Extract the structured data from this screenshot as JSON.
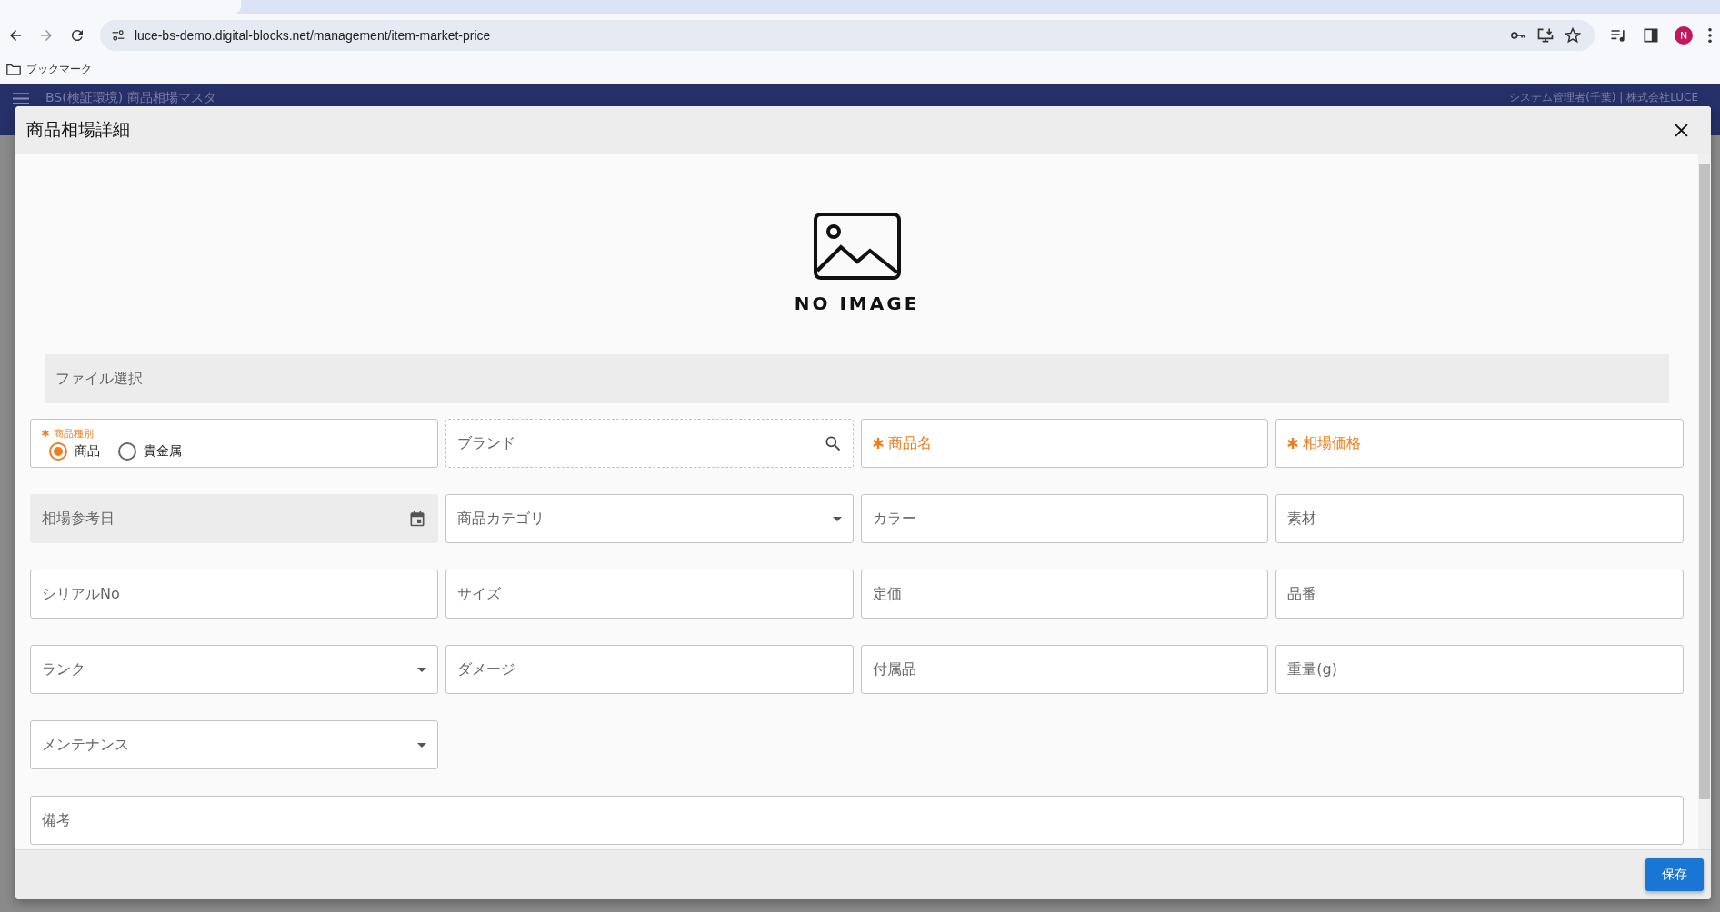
{
  "browser": {
    "url": "luce-bs-demo.digital-blocks.net/management/item-market-price",
    "bookmarks": [
      {
        "label": "ブックマーク"
      }
    ],
    "profile_initial": "N"
  },
  "app": {
    "title": "BS(検証環境) 商品相場マスタ",
    "user": "システム管理者(千葉) | 株式会社LUCE"
  },
  "dialog": {
    "title": "商品相場詳細",
    "image_caption": "NO IMAGE",
    "file_select": "ファイル選択",
    "fields": [
      {
        "kind": "radio",
        "label": "商品種別",
        "required": true,
        "options": [
          {
            "label": "商品",
            "selected": true
          },
          {
            "label": "貴金属",
            "selected": false
          }
        ]
      },
      {
        "kind": "search",
        "placeholder": "ブランド",
        "required": false
      },
      {
        "kind": "text",
        "placeholder": "商品名",
        "required": true
      },
      {
        "kind": "text",
        "placeholder": "相場価格",
        "required": true
      },
      {
        "kind": "date",
        "placeholder": "相場参考日",
        "required": false
      },
      {
        "kind": "select",
        "placeholder": "商品カテゴリ",
        "required": false
      },
      {
        "kind": "text",
        "placeholder": "カラー",
        "required": false
      },
      {
        "kind": "text",
        "placeholder": "素材",
        "required": false
      },
      {
        "kind": "text",
        "placeholder": "シリアルNo",
        "required": false
      },
      {
        "kind": "text",
        "placeholder": "サイズ",
        "required": false
      },
      {
        "kind": "text",
        "placeholder": "定価",
        "required": false
      },
      {
        "kind": "text",
        "placeholder": "品番",
        "required": false
      },
      {
        "kind": "select",
        "placeholder": "ランク",
        "required": false
      },
      {
        "kind": "text",
        "placeholder": "ダメージ",
        "required": false
      },
      {
        "kind": "text",
        "placeholder": "付属品",
        "required": false
      },
      {
        "kind": "text",
        "placeholder": "重量(g)",
        "required": false
      },
      {
        "kind": "select",
        "placeholder": "メンテナンス",
        "required": false
      },
      {
        "kind": "wide",
        "placeholder": "備考",
        "required": false
      }
    ],
    "save_button": "保存"
  }
}
